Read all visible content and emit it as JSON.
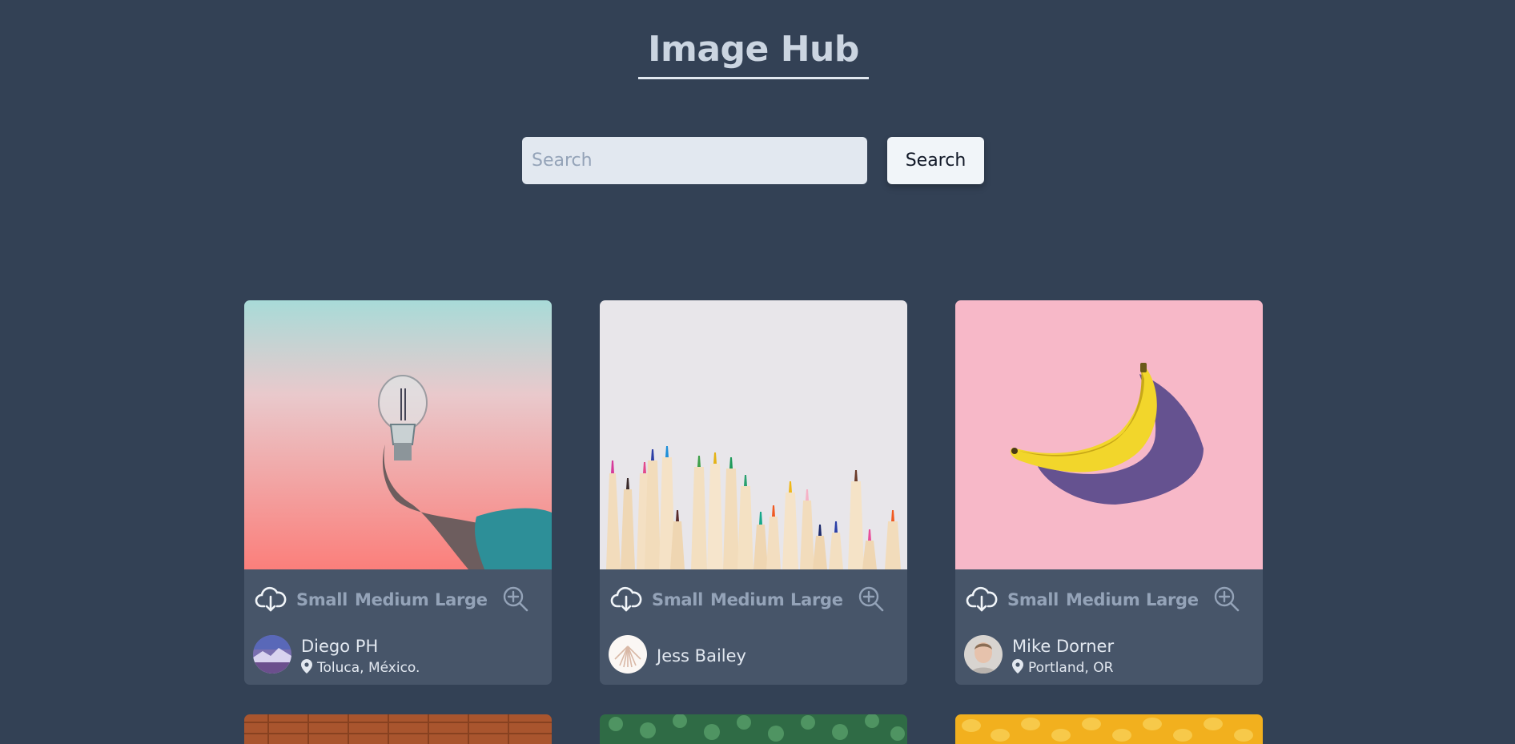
{
  "header": {
    "title": "Image Hub"
  },
  "search": {
    "placeholder": "Search",
    "value": "",
    "button_label": "Search"
  },
  "cards": [
    {
      "sizes": [
        "Small",
        "Medium",
        "Large"
      ],
      "author": "Diego PH",
      "location": "Toluca, México.",
      "image": "lightbulb-in-hand"
    },
    {
      "sizes": [
        "Small",
        "Medium",
        "Large"
      ],
      "author": "Jess Bailey",
      "location": "",
      "image": "colored-pencils"
    },
    {
      "sizes": [
        "Small",
        "Medium",
        "Large"
      ],
      "author": "Mike Dorner",
      "location": "Portland, OR",
      "image": "banana-on-pink"
    }
  ],
  "icons": {
    "download": "cloud-download-icon",
    "zoom": "zoom-in-icon",
    "location": "map-pin-icon"
  },
  "colors": {
    "background": "#334155",
    "card": "#475569",
    "muted_text": "#94a3b8",
    "text": "#e2e8f0"
  }
}
